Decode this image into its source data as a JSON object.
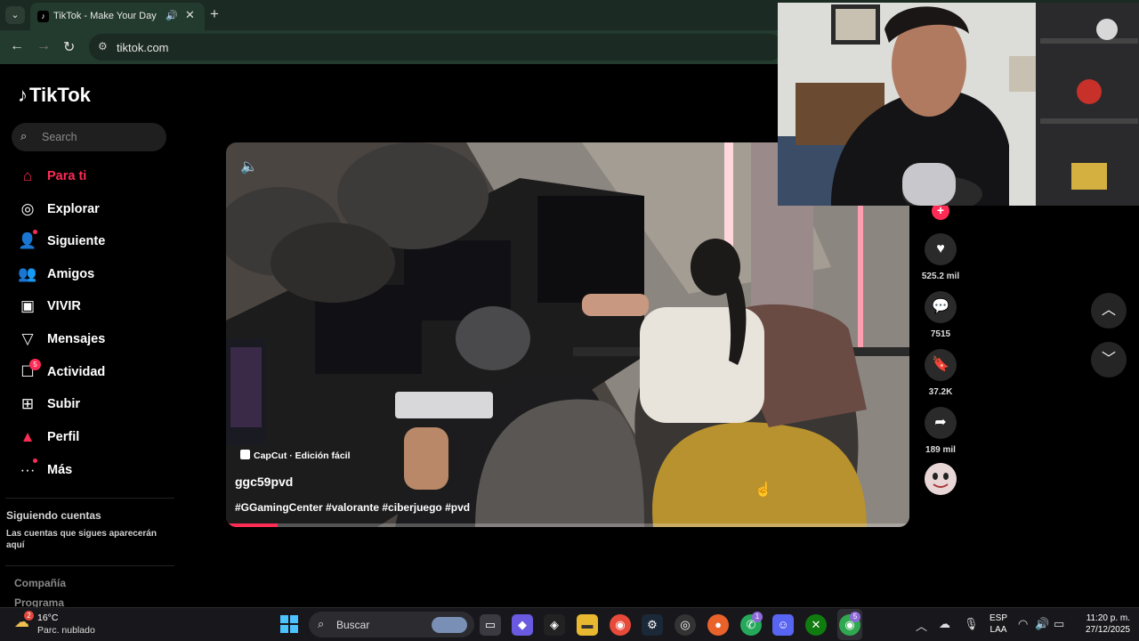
{
  "browser": {
    "tab_title": "TikTok - Make Your Day",
    "url": "tiktok.com"
  },
  "sidebar": {
    "logo": "TikTok",
    "search_placeholder": "Search",
    "nav": [
      {
        "label": "Para ti",
        "icon": "home-icon",
        "active": true
      },
      {
        "label": "Explorar",
        "icon": "compass-icon"
      },
      {
        "label": "Siguiente",
        "icon": "following-icon"
      },
      {
        "label": "Amigos",
        "icon": "friends-icon"
      },
      {
        "label": "VIVIR",
        "icon": "live-icon"
      },
      {
        "label": "Mensajes",
        "icon": "messages-icon"
      },
      {
        "label": "Actividad",
        "icon": "activity-icon",
        "badge": "5"
      },
      {
        "label": "Subir",
        "icon": "upload-icon"
      },
      {
        "label": "Perfil",
        "icon": "profile-icon"
      },
      {
        "label": "Más",
        "icon": "more-icon"
      }
    ],
    "following_title": "Siguiendo cuentas",
    "following_text": "Las cuentas que sigues aparecerán aquí",
    "footer_links": [
      "Compañía",
      "Programa"
    ]
  },
  "video": {
    "capcut_label": "CapCut · Edición fácil",
    "author": "ggc59pvd",
    "hashtags": "#GGamingCenter #valorante #ciberjuego #pvd",
    "progress": 0.075
  },
  "actions": {
    "likes": "525.2 mil",
    "comments": "7515",
    "saves": "37.2K",
    "shares": "189 mil"
  },
  "taskbar": {
    "weather_badge": "2",
    "temperature": "16°C",
    "condition": "Parc. nublado",
    "search_label": "Buscar",
    "notification_badge": "1",
    "chrome_badge": "5",
    "language": "ESP",
    "layout": "LAA",
    "time": "11:20 p. m.",
    "date": "27/12/2025"
  },
  "colors": {
    "accent": "#fe2c55",
    "browser_bg": "#233a2e",
    "taskbar_bg": "#18181c"
  }
}
